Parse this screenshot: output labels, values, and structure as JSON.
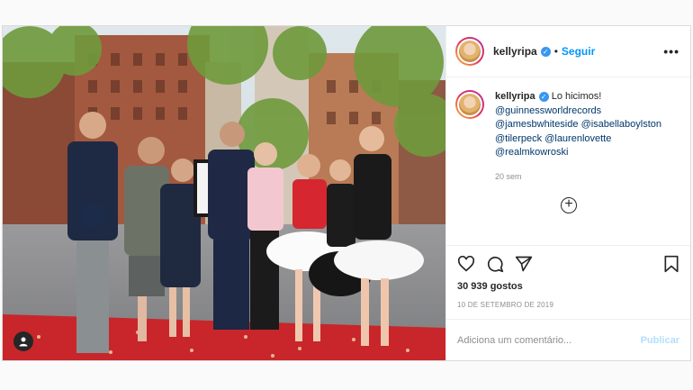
{
  "post": {
    "image_description_icon": "person-tag-icon"
  },
  "header": {
    "username": "kellyripa",
    "separator": "•",
    "follow_label": "Seguir",
    "more_label": "•••"
  },
  "caption": {
    "username": "kellyripa",
    "text": "Lo hicimos!",
    "mentions": [
      "@guinnessworldrecords",
      "@jamesbwhiteside",
      "@isabellaboylston",
      "@tilerpeck",
      "@laurenlovette",
      "@realmkowroski"
    ],
    "time": "20 sem"
  },
  "load_more_label": "+",
  "likes": "30 939 gostos",
  "date": "10 DE SETEMBRO DE 2019",
  "comment": {
    "placeholder": "Adiciona um comentário...",
    "publish_label": "Publicar"
  },
  "colors": {
    "accent": "#0095f6",
    "text": "#262626",
    "muted": "#8e8e8e"
  }
}
